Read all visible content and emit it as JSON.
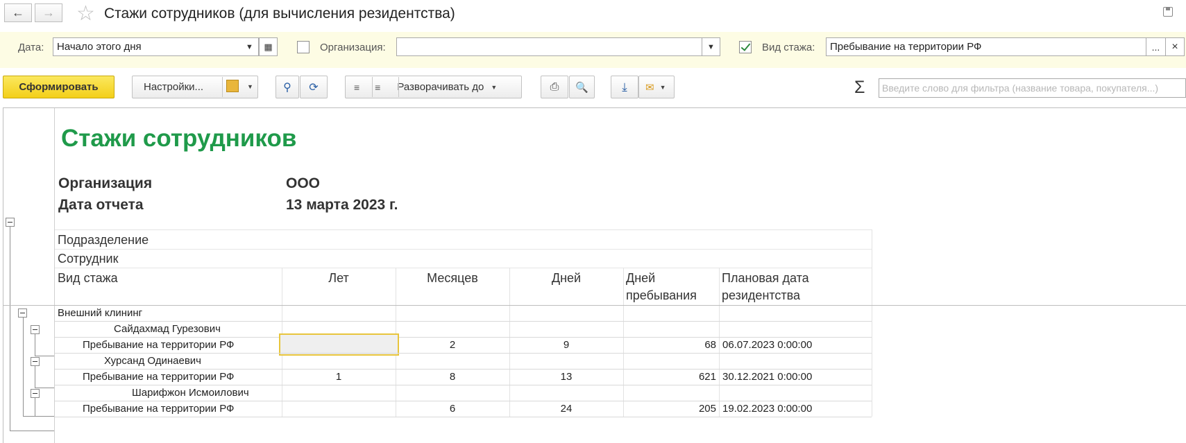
{
  "window": {
    "title": "Стажи сотрудников (для вычисления резидентства)"
  },
  "filters": {
    "date_label": "Дата:",
    "date_value": "Начало этого дня",
    "org_label": "Организация:",
    "org_value": "",
    "org_checked": false,
    "type_label": "Вид стажа:",
    "type_value": "Пребывание на территории РФ",
    "type_checked": true,
    "more_button": "...",
    "clear_button": "×"
  },
  "toolbar": {
    "generate_label": "Сформировать",
    "settings_label": "Настройки...",
    "expand_label": "Разворачивать до",
    "filter_placeholder": "Введите слово для фильтра (название товара, покупателя...)"
  },
  "report": {
    "title": "Стажи сотрудников",
    "params": [
      {
        "label": "Организация",
        "value": "ООО"
      },
      {
        "label": "Дата отчета",
        "value": "13 марта 2023 г."
      }
    ],
    "headers": {
      "department": "Подразделение",
      "employee": "Сотрудник",
      "type": "Вид стажа",
      "years": "Лет",
      "months": "Месяцев",
      "days": "Дней",
      "stay_days_1": "Дней",
      "stay_days_2": "пребывания",
      "plan_date_1": "Плановая дата",
      "plan_date_2": "резидентства"
    },
    "group": "Внешний клининг",
    "employees": [
      {
        "name": "Сайдахмад Гурезович",
        "type": "Пребывание на территории РФ",
        "years": "",
        "months": "2",
        "days": "9",
        "stay_days": "68",
        "plan_date": "06.07.2023 0:00:00"
      },
      {
        "name": "Хурсанд Одинаевич",
        "type": "Пребывание на территории РФ",
        "years": "1",
        "months": "8",
        "days": "13",
        "stay_days": "621",
        "plan_date": "30.12.2021 0:00:00"
      },
      {
        "name": "Шарифжон Исмоилович",
        "type": "Пребывание на территории РФ",
        "years": "",
        "months": "6",
        "days": "24",
        "stay_days": "205",
        "plan_date": "19.02.2023 0:00:00"
      }
    ]
  }
}
